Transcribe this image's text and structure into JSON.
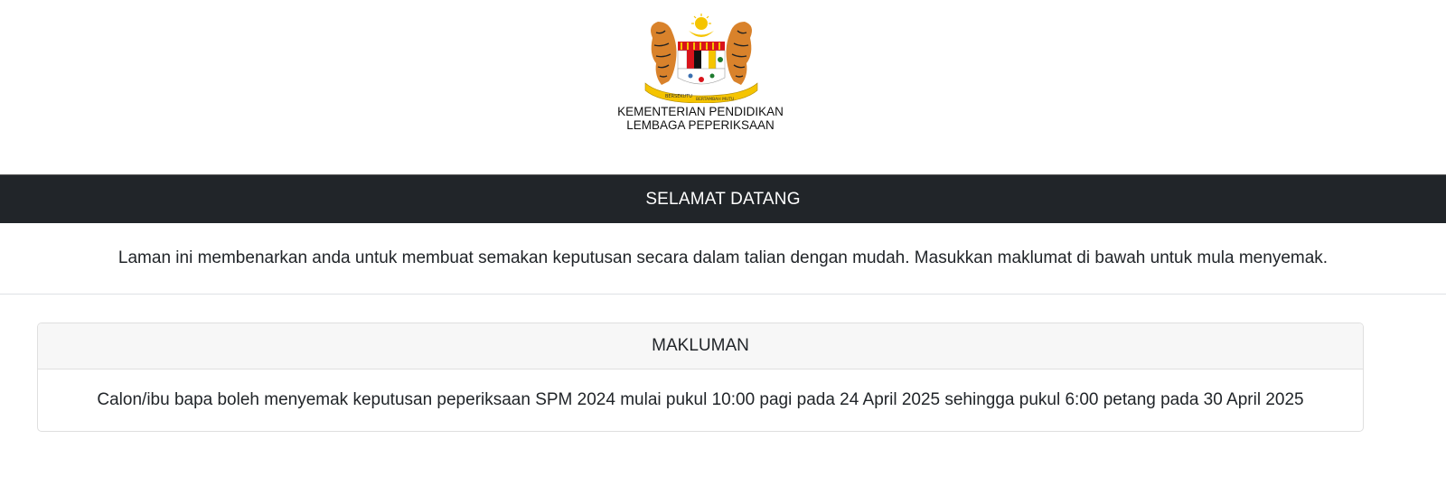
{
  "header": {
    "crest_icon": "malaysia-coat-of-arms-icon",
    "org_line1": "KEMENTERIAN PENDIDIKAN",
    "org_line2": "LEMBAGA PEPERIKSAAN",
    "crest_ribbon_left": "BERSEKUTU",
    "crest_ribbon_right": "BERTAMBAH MUTU"
  },
  "welcome_bar": {
    "title": "SELAMAT DATANG",
    "bg_color": "#212529"
  },
  "intro": {
    "text": "Laman ini membenarkan anda untuk membuat semakan keputusan secara dalam talian dengan mudah. Masukkan maklumat di bawah untuk mula menyemak."
  },
  "notice_card": {
    "title": "MAKLUMAN",
    "body": "Calon/ibu bapa boleh menyemak keputusan peperiksaan SPM 2024 mulai pukul 10:00 pagi pada 24 April 2025 sehingga pukul 6:00 petang pada 30 April 2025"
  }
}
